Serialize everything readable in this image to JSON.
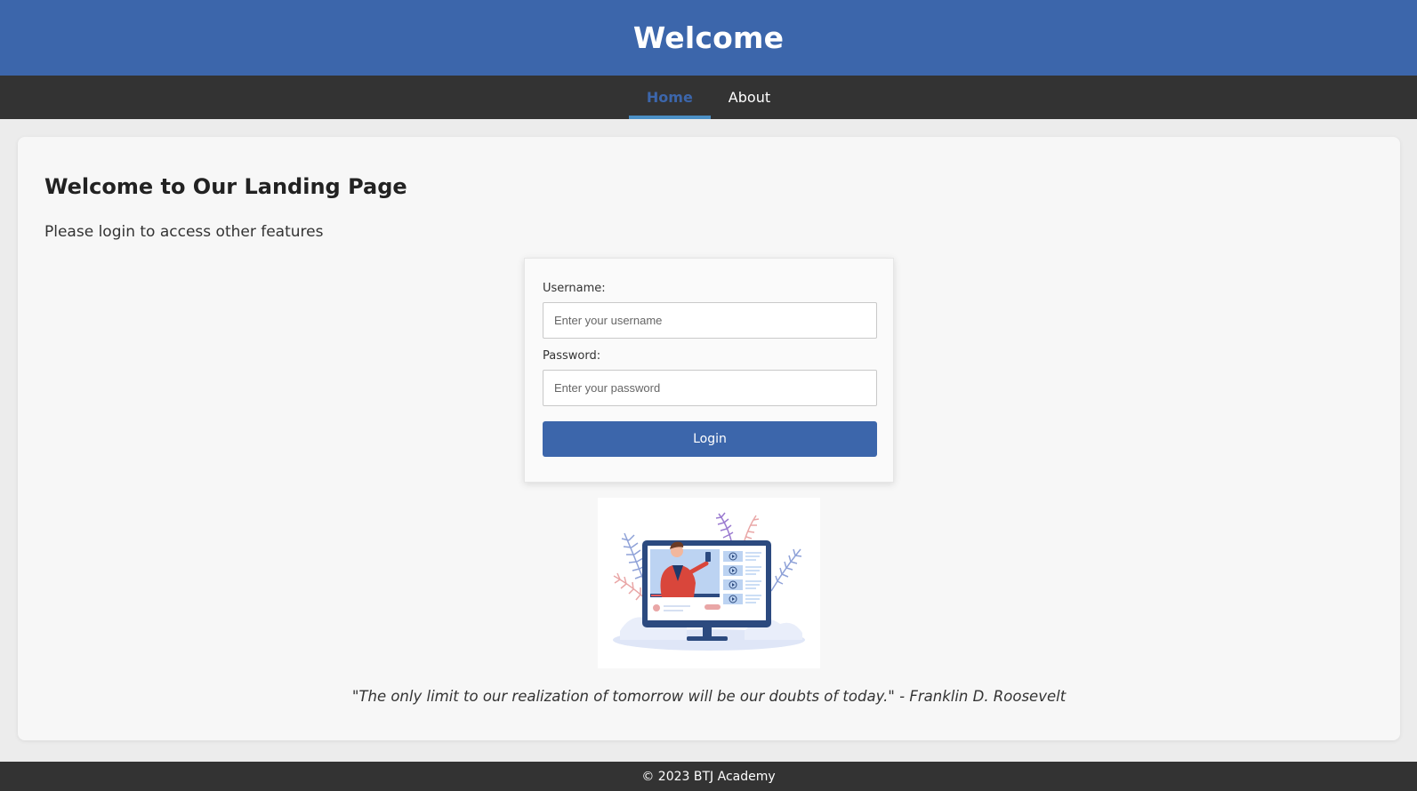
{
  "header": {
    "title": "Welcome"
  },
  "nav": {
    "items": [
      {
        "label": "Home",
        "active": true
      },
      {
        "label": "About",
        "active": false
      }
    ],
    "active_color": "#3c66ab",
    "indicator_color": "#4b90c6"
  },
  "main": {
    "heading": "Welcome to Our Landing Page",
    "subtitle": "Please login to access other features"
  },
  "login": {
    "username_label": "Username:",
    "username_placeholder": "Enter your username",
    "password_label": "Password:",
    "password_placeholder": "Enter your password",
    "button_label": "Login"
  },
  "illustration": {
    "icon": "online-video-presenter-illustration"
  },
  "quote": "\"The only limit to our realization of tomorrow will be our doubts of today.\" - Franklin D. Roosevelt",
  "footer": {
    "text": "© 2023 BTJ Academy"
  },
  "colors": {
    "brand": "#3c66ab",
    "nav_bg": "#333333",
    "footer_bg": "#333333"
  }
}
